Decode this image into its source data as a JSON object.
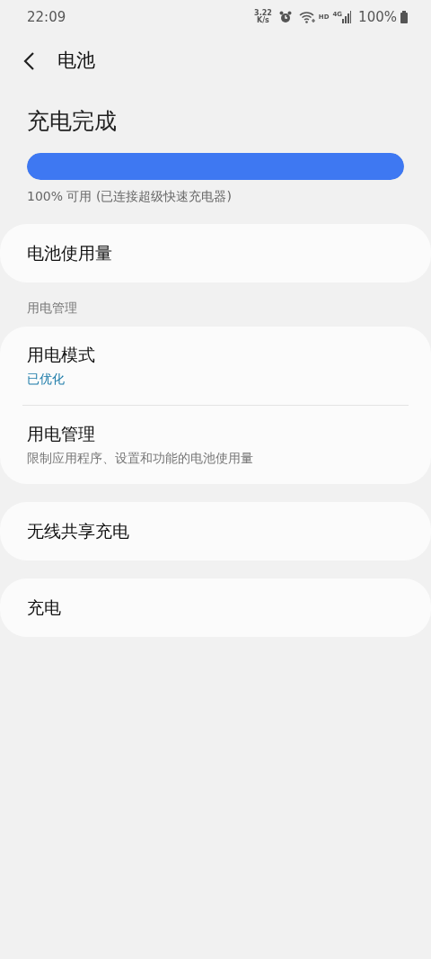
{
  "status_bar": {
    "time": "22:09",
    "net_speed": [
      "3.22",
      "K/s"
    ],
    "hd": "HD",
    "network": "4G",
    "battery": "100%"
  },
  "header": {
    "title": "电池"
  },
  "charge": {
    "title": "充电完成",
    "level": 1.0,
    "caption": "100% 可用 (已连接超级快速充电器)"
  },
  "groups": [
    {
      "items": [
        {
          "title": "电池使用量"
        }
      ]
    },
    {
      "section": "用电管理",
      "items": [
        {
          "title": "用电模式",
          "subtitle": "已优化",
          "kind": "status"
        },
        {
          "title": "用电管理",
          "subtitle": "限制应用程序、设置和功能的电池使用量",
          "kind": "description"
        }
      ]
    },
    {
      "items": [
        {
          "title": "无线共享充电"
        }
      ]
    },
    {
      "items": [
        {
          "title": "充电"
        }
      ]
    }
  ]
}
